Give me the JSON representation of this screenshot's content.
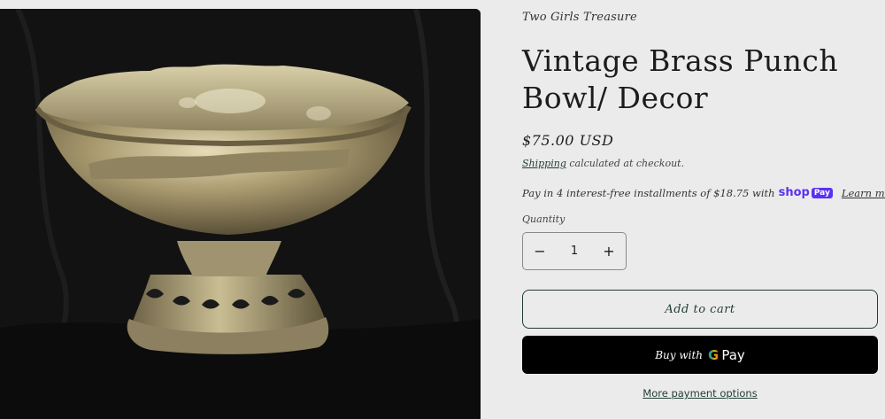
{
  "product": {
    "vendor": "Two Girls Treasure",
    "title": "Vintage Brass Punch Bowl/ Decor",
    "price": "$75.00 USD",
    "shipping_link": "Shipping",
    "shipping_rest": " calculated at checkout.",
    "installments_text": "Pay in 4 interest-free installments of $18.75 with",
    "shop_word": "shop",
    "shop_pay_chip": "Pay",
    "learn_more": "Learn more",
    "image_alt": "Brass punch bowl on black backdrop"
  },
  "quantity": {
    "label": "Quantity",
    "value": "1",
    "decrease_symbol": "−",
    "increase_symbol": "+"
  },
  "actions": {
    "add_to_cart": "Add to cart",
    "buy_with": "Buy with",
    "gpay_g": "G",
    "gpay_pay": "Pay",
    "more_payment": "More payment options"
  },
  "colors": {
    "background": "#ecebeb",
    "accent": "#1f3d35",
    "shop_pay": "#5a31f4",
    "buy_button": "#000000"
  }
}
